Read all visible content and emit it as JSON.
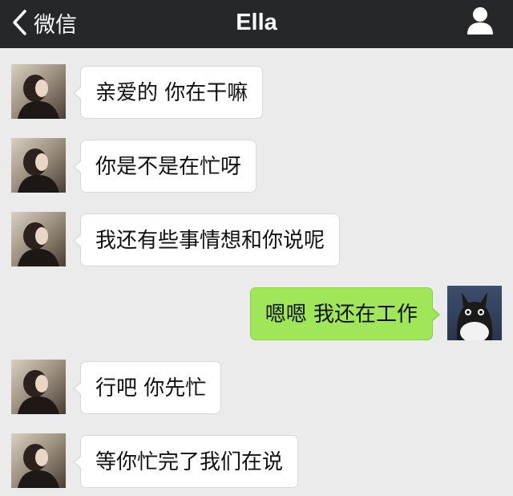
{
  "navbar": {
    "back_label": "微信",
    "title": "Ella",
    "back_icon": "chevron-left-icon",
    "profile_icon": "person-icon"
  },
  "colors": {
    "navbar_bg": "#262729",
    "chat_bg": "#ebebeb",
    "incoming_bubble": "#ffffff",
    "outgoing_bubble": "#9fe658"
  },
  "messages": [
    {
      "direction": "incoming",
      "sender": "Ella",
      "text": "亲爱的 你在干嘛"
    },
    {
      "direction": "incoming",
      "sender": "Ella",
      "text": "你是不是在忙呀"
    },
    {
      "direction": "incoming",
      "sender": "Ella",
      "text": "我还有些事情想和你说呢"
    },
    {
      "direction": "outgoing",
      "sender": "me",
      "text": "嗯嗯 我还在工作"
    },
    {
      "direction": "incoming",
      "sender": "Ella",
      "text": "行吧 你先忙"
    },
    {
      "direction": "incoming",
      "sender": "Ella",
      "text": "等你忙完了我们在说"
    }
  ]
}
